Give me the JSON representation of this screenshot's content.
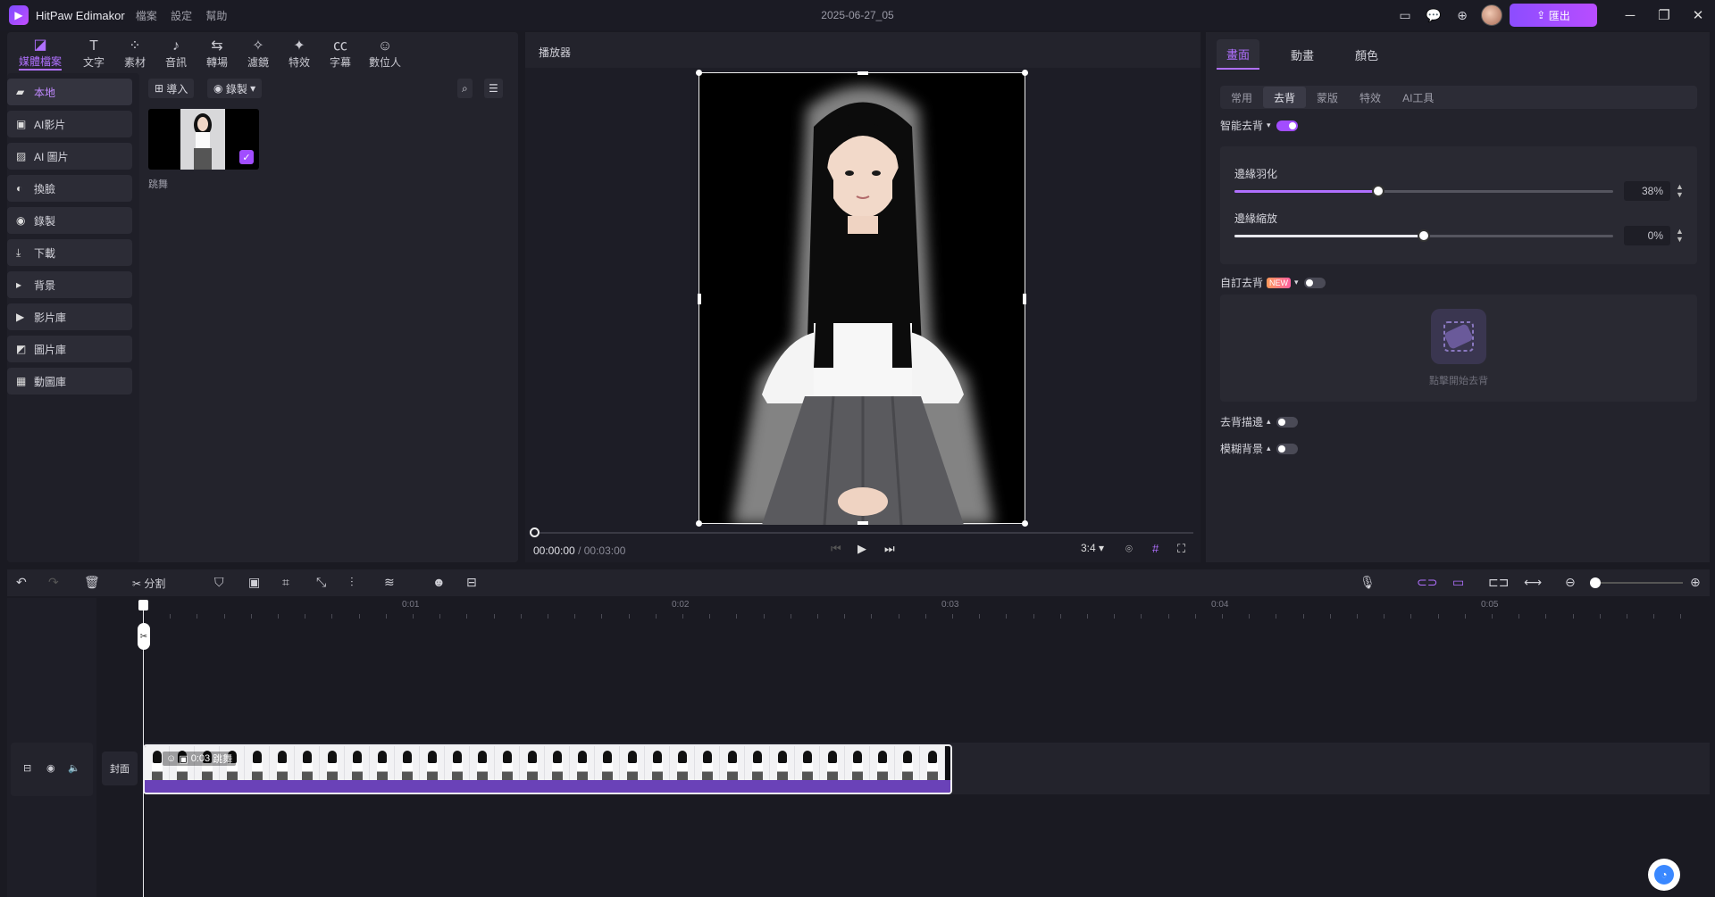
{
  "titlebar": {
    "app_name": "HitPaw Edimakor",
    "menu": [
      "檔案",
      "設定",
      "幫助"
    ],
    "project_title": "2025-06-27_05",
    "export_label": "匯出"
  },
  "top_tools": [
    {
      "label": "媒體檔案",
      "icon": "media-icon",
      "active": true
    },
    {
      "label": "文字",
      "icon": "text-icon"
    },
    {
      "label": "素材",
      "icon": "assets-icon"
    },
    {
      "label": "音訊",
      "icon": "music-icon"
    },
    {
      "label": "轉場",
      "icon": "transition-icon"
    },
    {
      "label": "濾鏡",
      "icon": "filter-icon"
    },
    {
      "label": "特效",
      "icon": "effects-icon"
    },
    {
      "label": "字幕",
      "icon": "subtitle-icon"
    },
    {
      "label": "數位人",
      "icon": "avatar-icon"
    }
  ],
  "sidebar": {
    "items": [
      {
        "label": "本地",
        "icon": "folder-icon",
        "active": true
      },
      {
        "label": "AI影片",
        "icon": "ai-video-icon"
      },
      {
        "label": "AI 圖片",
        "icon": "ai-image-icon"
      },
      {
        "label": "換臉",
        "icon": "face-swap-icon"
      },
      {
        "label": "錄製",
        "icon": "record-icon"
      },
      {
        "label": "下載",
        "icon": "download-icon"
      },
      {
        "label": "背景",
        "icon": "background-icon"
      },
      {
        "label": "影片庫",
        "icon": "video-library-icon"
      },
      {
        "label": "圖片庫",
        "icon": "image-library-icon"
      },
      {
        "label": "動圖庫",
        "icon": "gif-library-icon"
      }
    ]
  },
  "media": {
    "import_label": "導入",
    "record_label": "錄製",
    "thumb_name": "跳舞"
  },
  "player": {
    "title": "播放器",
    "current_time": "00:00:00",
    "total_time": "/ 00:03:00",
    "aspect": "3:4"
  },
  "props": {
    "tabs": [
      "畫面",
      "動畫",
      "顏色"
    ],
    "subtabs": [
      "常用",
      "去背",
      "蒙版",
      "特效",
      "AI工具"
    ],
    "smart_bg_label": "智能去背",
    "smart_bg_on": true,
    "edge_feather_label": "邊緣羽化",
    "edge_feather_value": "38%",
    "edge_feather_fraction": 0.38,
    "edge_scale_label": "邊緣縮放",
    "edge_scale_value": "0%",
    "edge_scale_fraction": 0.5,
    "custom_bg_label": "自訂去背",
    "new_badge": "NEW",
    "custom_bg_on": false,
    "custom_bg_hint": "點擊開始去背",
    "outline_label": "去背描邊",
    "outline_on": false,
    "blur_bg_label": "模糊背景",
    "blur_bg_on": false
  },
  "timeline": {
    "split_label": "分割",
    "ruler": [
      "0:01",
      "0:02",
      "0:03",
      "0:04",
      "0:05"
    ],
    "cover_label": "封面",
    "clip_duration": "0:03",
    "clip_name": "跳舞"
  },
  "colors": {
    "accent": "#a24dff",
    "clip_bar": "#6a42b8"
  }
}
